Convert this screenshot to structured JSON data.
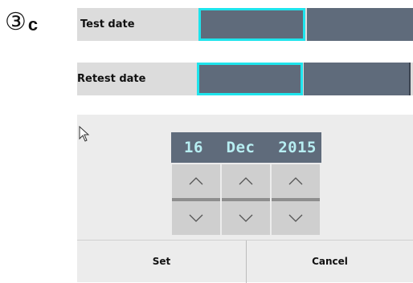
{
  "step_marker": {
    "number": "③",
    "letter": "c"
  },
  "fields": [
    {
      "label": "Test date"
    },
    {
      "label": "Retest date"
    }
  ],
  "picker": {
    "day": "16",
    "month": "Dec",
    "year": "2015",
    "set_label": "Set",
    "cancel_label": "Cancel"
  },
  "colors": {
    "field_bg": "#5f6b7b",
    "focus_border": "#1ee4ec",
    "date_text": "#b7eef2",
    "row_bg": "#dcdcdc",
    "picker_bg": "#ececec",
    "arrow_button_bg": "#cfcfcf"
  },
  "icons": [
    "cursor-icon",
    "chevron-up-icon",
    "chevron-down-icon"
  ]
}
